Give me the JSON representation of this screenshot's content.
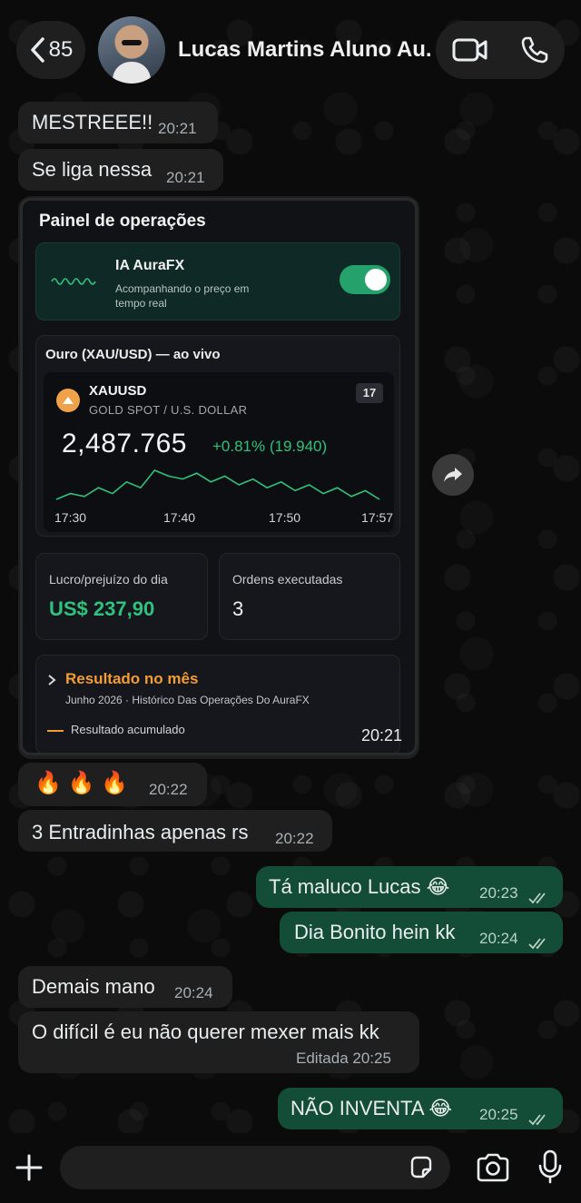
{
  "header": {
    "back_count": "85",
    "contact_name": "Lucas Martins Aluno Au..."
  },
  "messages": [
    {
      "text": "MESTREEE!!",
      "time": "20:21"
    },
    {
      "text": "Se liga nessa",
      "time": "20:21"
    },
    {
      "text": "🔥 🔥 🔥",
      "time": "20:22"
    },
    {
      "text": "3 Entradinhas apenas rs",
      "time": "20:22"
    },
    {
      "text": "Tá maluco Lucas 😂",
      "time": "20:23"
    },
    {
      "text": "Dia Bonito hein kk",
      "time": "20:24"
    },
    {
      "text": "Demais mano",
      "time": "20:24"
    },
    {
      "text": "O difícil é eu não querer mexer mais kk",
      "time": "Editada 20:25"
    },
    {
      "text": "NÃO INVENTA 😂",
      "time": "20:25"
    }
  ],
  "card": {
    "title": "Painel de operações",
    "ia_title": "IA AuraFX",
    "ia_subtitle": "Acompanhando o preço em tempo real",
    "ia_toggle_on": true,
    "gold_label": "Ouro (XAU/USD) — ao vivo",
    "symbol": "XAUUSD",
    "symbol_desc": "GOLD SPOT / U.S. DOLLAR",
    "tv_logo": "17",
    "price": "2,487.765",
    "change": "+0.81% (19.940)",
    "pnl_label": "Lucro/prejuízo do dia",
    "pnl_value": "US$ 237,90",
    "orders_label": "Ordens executadas",
    "orders_value": "3",
    "month_title": "Resultado no mês",
    "month_sub": "Junho 2026 · Histórico Das Operações Do AuraFX",
    "legend": "Resultado acumulado",
    "time": "20:21"
  },
  "chart_data": {
    "type": "line",
    "title": "",
    "x_ticks": [
      "17:30",
      "17:40",
      "17:50",
      "17:57"
    ],
    "values": [
      3,
      4,
      3.5,
      5,
      4,
      6,
      5,
      8,
      7,
      6.5,
      7.5,
      6,
      7,
      5.5,
      6.5,
      5,
      6,
      4.5,
      5.5,
      4,
      5,
      3.5,
      4.5,
      3
    ],
    "color": "#2ec27e"
  },
  "colors": {
    "incoming_bubble": "#1f1f1f",
    "outgoing_bubble": "#144d37",
    "accent_green": "#2ec27e",
    "accent_orange": "#f39c34"
  },
  "icons": {
    "back": "chevron-left-icon",
    "video": "video-call-icon",
    "phone": "phone-icon",
    "forward": "forward-icon",
    "plus": "plus-icon",
    "sticker": "sticker-icon",
    "camera": "camera-icon",
    "mic": "mic-icon"
  }
}
